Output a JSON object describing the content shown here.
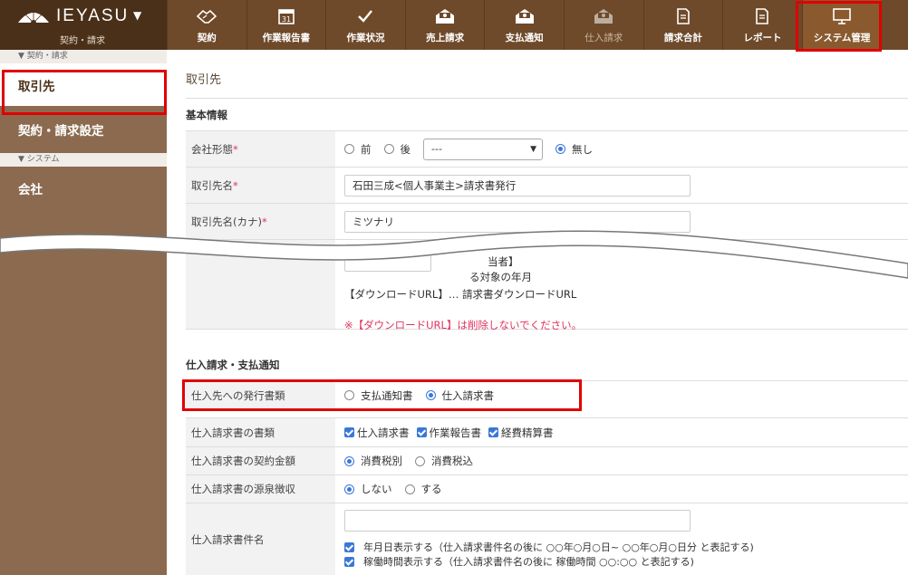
{
  "brand": {
    "name": "IEYASU",
    "caret": "▼",
    "subtitle": "契約・請求"
  },
  "nav": [
    {
      "label": "契約",
      "icon": "handshake-icon",
      "state": "normal"
    },
    {
      "label": "作業報告書",
      "icon": "calendar-icon",
      "day": "31",
      "state": "normal"
    },
    {
      "label": "作業状況",
      "icon": "check-icon",
      "state": "normal"
    },
    {
      "label": "売上請求",
      "icon": "money-envelope-icon",
      "state": "normal"
    },
    {
      "label": "支払通知",
      "icon": "money-envelope-icon",
      "state": "normal"
    },
    {
      "label": "仕入請求",
      "icon": "money-envelope-icon",
      "state": "dim"
    },
    {
      "label": "請求合計",
      "icon": "document-icon",
      "state": "normal"
    },
    {
      "label": "レポート",
      "icon": "document-icon",
      "state": "normal"
    },
    {
      "label": "システム管理",
      "icon": "monitor-icon",
      "state": "active"
    }
  ],
  "sidebar": {
    "section1": "▼ 契約・請求",
    "item1": "取引先",
    "item2": "契約・請求設定",
    "section2": "▼ システム",
    "item3": "会社"
  },
  "page": {
    "title": "取引先",
    "basic_section": "基本情報",
    "company_type_label": "会社形態",
    "before_label": "前",
    "after_label": "後",
    "select_value": "---",
    "none_label": "無し",
    "name_label": "取引先名",
    "name_value": "石田三成<個人事業主>請求書発行",
    "kana_label": "取引先名(カナ)",
    "kana_value": "ミツナリ",
    "frag1": "当者】",
    "frag2": "る対象の年月",
    "download_line": "【ダウンロードURL】… 請求書ダウンロードURL",
    "warning": "※【ダウンロードURL】は削除しないでください。",
    "required_mark": "*"
  },
  "purchase": {
    "section": "仕入請求・支払通知",
    "doc_type_label": "仕入先への発行書類",
    "opt_payment_notice": "支払通知書",
    "opt_purchase_invoice": "仕入請求書",
    "docs_label": "仕入請求書の書類",
    "doc1": "仕入請求書",
    "doc2": "作業報告書",
    "doc3": "経費精算書",
    "amount_label": "仕入請求書の契約金額",
    "tax_excl": "消費税別",
    "tax_incl": "消費税込",
    "withhold_label": "仕入請求書の源泉徴収",
    "no": "しない",
    "yes": "する",
    "subject_label": "仕入請求書件名",
    "subject_value": "",
    "check1": "年月日表示する（仕入請求書件名の後に ○○年○月○日~ ○○年○月○日分 と表記する)",
    "check2": "稼働時間表示する（仕入請求書件名の後に 稼働時間 ○○:○○ と表記する)"
  },
  "colors": {
    "accent": "#6e4a2a",
    "highlight": "#e00000",
    "radio": "#3a78d8",
    "required": "#e0335f"
  }
}
